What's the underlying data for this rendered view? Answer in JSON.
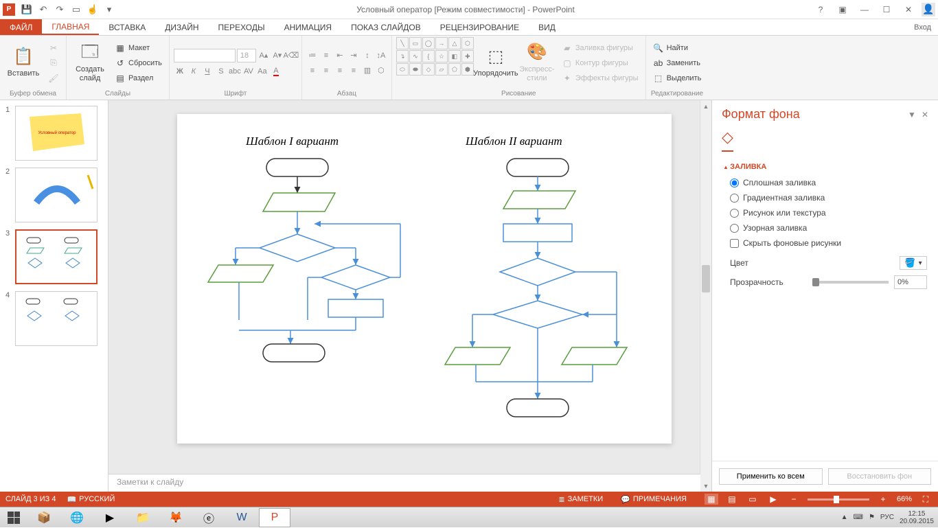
{
  "titlebar": {
    "app_icon": "P",
    "title": "Условный оператор [Режим совместимости] - PowerPoint"
  },
  "tabs": {
    "file": "ФАЙЛ",
    "home": "ГЛАВНАЯ",
    "insert": "ВСТАВКА",
    "design": "ДИЗАЙН",
    "transitions": "ПЕРЕХОДЫ",
    "animations": "АНИМАЦИЯ",
    "slideshow": "ПОКАЗ СЛАЙДОВ",
    "review": "РЕЦЕНЗИРОВАНИЕ",
    "view": "ВИД",
    "signin": "Вход"
  },
  "ribbon": {
    "clipboard": {
      "paste": "Вставить",
      "label": "Буфер обмена"
    },
    "slides": {
      "new": "Создать слайд",
      "layout": "Макет",
      "reset": "Сбросить",
      "section": "Раздел",
      "label": "Слайды"
    },
    "font": {
      "size": "18",
      "label": "Шрифт"
    },
    "paragraph": {
      "label": "Абзац"
    },
    "drawing": {
      "arrange": "Упорядочить",
      "styles": "Экспресс-стили",
      "fill": "Заливка фигуры",
      "outline": "Контур фигуры",
      "effects": "Эффекты фигуры",
      "label": "Рисование"
    },
    "editing": {
      "find": "Найти",
      "replace": "Заменить",
      "select": "Выделить",
      "label": "Редактирование"
    }
  },
  "thumbs": {
    "n1": "1",
    "n2": "2",
    "n3": "3",
    "n4": "4"
  },
  "slide": {
    "titleLeft": "Шаблон I вариант",
    "titleRight": "Шаблон II вариант"
  },
  "notes": {
    "placeholder": "Заметки к слайду"
  },
  "pane": {
    "title": "Формат фона",
    "section_fill": "ЗАЛИВКА",
    "solid": "Сплошная заливка",
    "gradient": "Градиентная заливка",
    "picture": "Рисунок или текстура",
    "pattern": "Узорная заливка",
    "hidebg": "Скрыть фоновые рисунки",
    "color": "Цвет",
    "transparency": "Прозрачность",
    "transparency_val": "0%",
    "apply_all": "Применить ко всем",
    "reset": "Восстановить фон"
  },
  "status": {
    "slide_info": "СЛАЙД 3 ИЗ 4",
    "lang": "РУССКИЙ",
    "notes": "ЗАМЕТКИ",
    "comments": "ПРИМЕЧАНИЯ",
    "zoom": "66%"
  },
  "tray": {
    "lang": "РУС",
    "time": "12:15",
    "date": "20.09.2015"
  }
}
